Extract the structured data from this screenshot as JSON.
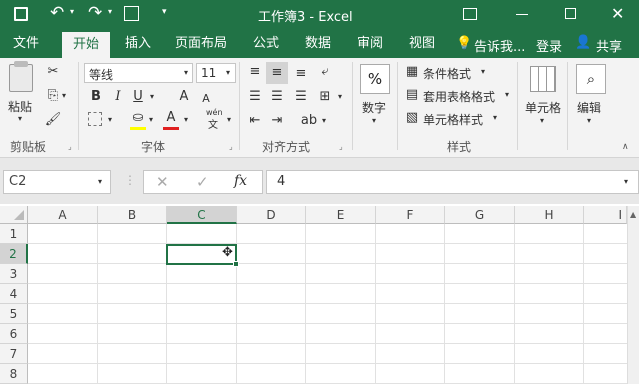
{
  "titlebar": {
    "title": "工作簿3 - Excel",
    "save_icon": "save-icon",
    "undo_icon": "undo-icon",
    "redo_icon": "redo-icon"
  },
  "tabs": [
    {
      "label": "文件",
      "active": false
    },
    {
      "label": "开始",
      "active": true
    },
    {
      "label": "插入",
      "active": false
    },
    {
      "label": "页面布局",
      "active": false
    },
    {
      "label": "公式",
      "active": false
    },
    {
      "label": "数据",
      "active": false
    },
    {
      "label": "审阅",
      "active": false
    },
    {
      "label": "视图",
      "active": false
    }
  ],
  "tellme": "告诉我...",
  "login": "登录",
  "share": "共享",
  "ribbon": {
    "paste_label": "粘贴",
    "font_name": "等线",
    "font_size": "11",
    "wen_label": "wén",
    "percent_symbol": "%",
    "number_label": "数字",
    "conditional_format": "条件格式",
    "table_format": "套用表格格式",
    "cell_styles": "单元格样式",
    "cells_label": "单元格",
    "edit_label": "编辑",
    "groups": {
      "clipboard": "剪贴板",
      "font": "字体",
      "alignment": "对齐方式",
      "styles": "样式"
    }
  },
  "formula_bar": {
    "name_box": "C2",
    "formula": "4"
  },
  "grid": {
    "columns": [
      "A",
      "B",
      "C",
      "D",
      "E",
      "F",
      "G",
      "H",
      "I"
    ],
    "rows": [
      "1",
      "2",
      "3",
      "4",
      "5",
      "6",
      "7",
      "8"
    ],
    "selected_cell": "C2"
  },
  "colors": {
    "brand": "#217346"
  }
}
